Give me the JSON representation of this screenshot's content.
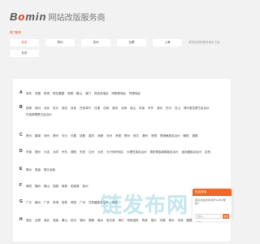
{
  "header": {
    "brand_prefix": "B",
    "brand_accent": "o",
    "brand_suffix": "min",
    "site_name": "网站改版服务商"
  },
  "hot": {
    "title": "热门城市",
    "row1": [
      "北京",
      "郑州",
      "苏州",
      "合肥",
      "上海"
    ],
    "row2": [
      "北京"
    ],
    "note": "我有优质的服务请点下此"
  },
  "letters": [
    {
      "letter": "A",
      "cities": [
        "安庆",
        "安徽",
        "阿坝",
        "阿拉善盟",
        "安顺",
        "鞍山",
        "澳门",
        "阿克苏地区",
        "阿勒泰地区",
        "阿里地区"
      ]
    },
    {
      "letter": "B",
      "cities": [
        "蚌埠",
        "亳州",
        "北京",
        "包头",
        "保定",
        "百色",
        "巴彦淖尔",
        "白银",
        "白城",
        "宝鸡",
        "北海",
        "保山",
        "本溪",
        "毕节",
        "滨州",
        "巴中",
        "白山",
        "博尔塔拉蒙古自治州",
        "巴音郭楞蒙古自治州"
      ]
    },
    {
      "letter": "C",
      "cities": [
        "常州",
        "巢湖",
        "池州",
        "滁州",
        "长沙",
        "长春",
        "成都",
        "重庆",
        "赤峰",
        "沧州",
        "承德",
        "郴州",
        "崇左",
        "潮州",
        "常德",
        "楚雄彝族自治州",
        "朝阳",
        "昌都"
      ]
    },
    {
      "letter": "D",
      "cities": [
        "东营",
        "德州",
        "大连",
        "大同",
        "丹东",
        "德阳",
        "东莞",
        "达州",
        "大庆",
        "大兴安岭地区",
        "大理白族自治州",
        "德宏傣族景颇族自治州",
        "迪庆藏族自治州",
        "定西"
      ]
    },
    {
      "letter": "E",
      "cities": [
        "鄂州",
        "恩施",
        "鄂尔多斯"
      ]
    },
    {
      "letter": "F",
      "cities": [
        "阜阳",
        "福州",
        "佛山",
        "抚顺",
        "阜新",
        "防城港",
        "抚州"
      ]
    },
    {
      "letter": "G",
      "cities": [
        "广元",
        "赣州",
        "广安",
        "贵港",
        "桂林",
        "贵阳",
        "广州",
        "甘孜藏族自治州",
        "固原"
      ]
    },
    {
      "letter": "H",
      "cities": [
        "淮安",
        "合肥",
        "淮北",
        "淮南",
        "黄山",
        "杭州",
        "湖州",
        "邯郸",
        "衡水",
        "哈尔滨",
        "海口",
        "呼和浩特",
        "菏泽",
        "惠州",
        "河源",
        "贺州",
        "河池",
        "鹤壁",
        "黄石"
      ]
    }
  ],
  "chat": {
    "header": "在线咨询",
    "body": "您好,欢迎访问,有什么可以帮您?",
    "placeholder": "请输入",
    "send": "发送"
  },
  "watermark": "链发布网"
}
